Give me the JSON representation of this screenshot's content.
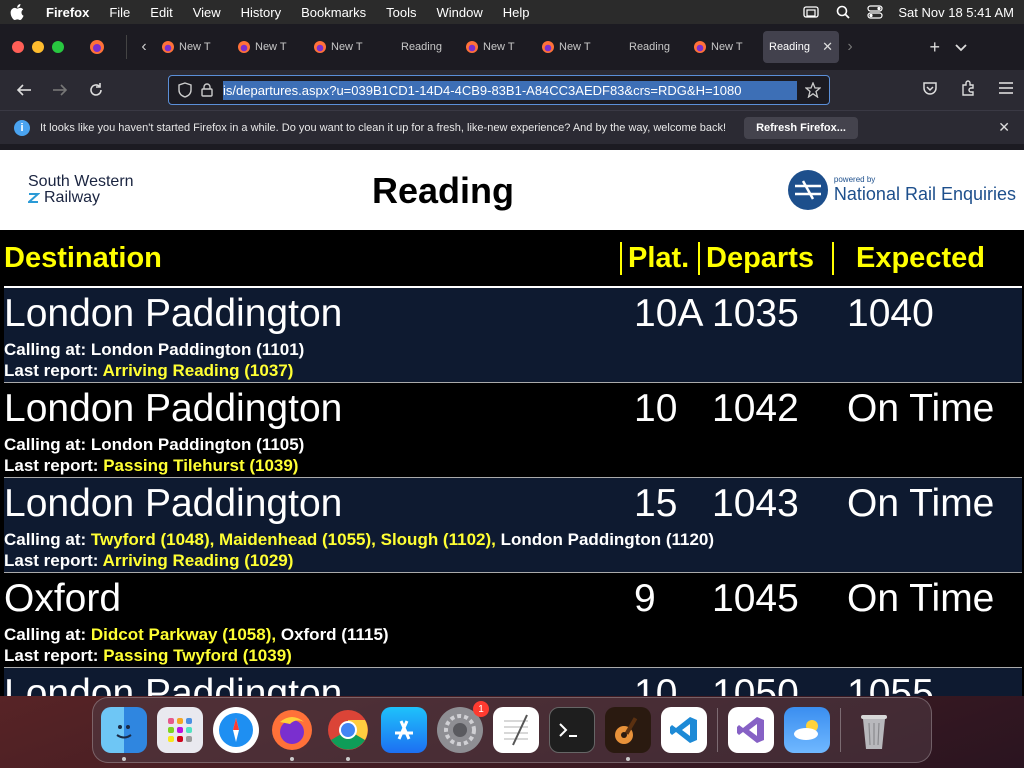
{
  "menubar": {
    "app_name": "Firefox",
    "items": [
      "File",
      "Edit",
      "View",
      "History",
      "Bookmarks",
      "Tools",
      "Window",
      "Help"
    ],
    "datetime": "Sat Nov 18  5:41 AM"
  },
  "browser": {
    "tabs": [
      {
        "label": "New T"
      },
      {
        "label": "New T"
      },
      {
        "label": "New T"
      },
      {
        "label": "Reading"
      },
      {
        "label": "New T"
      },
      {
        "label": "New T"
      },
      {
        "label": "Reading"
      },
      {
        "label": "New T"
      },
      {
        "label": "Reading",
        "active": true
      }
    ],
    "url": "is/departures.aspx?u=039B1CD1-14D4-4CB9-83B1-A84CC3AEDF83&crs=RDG&H=1080",
    "notification": {
      "text": "It looks like you haven't started Firefox in a while. Do you want to clean it up for a fresh, like-new experience? And by the way, welcome back!",
      "button": "Refresh Firefox..."
    }
  },
  "page": {
    "operator_logo_line1": "South Western",
    "operator_logo_line2": "Railway",
    "title": "Reading",
    "nre_small": "powered by",
    "nre_big": "National Rail Enquiries",
    "headers": {
      "destination": "Destination",
      "platform": "Plat.",
      "departs": "Departs",
      "expected": "Expected"
    },
    "calling_label": "Calling at:",
    "report_label": "Last report:",
    "rows": [
      {
        "destination": "London Paddington",
        "platform": "10A",
        "departs": "1035",
        "expected": "1040",
        "calling_yellow": "",
        "calling_white": "London Paddington (1101)",
        "report": "Arriving Reading (1037)"
      },
      {
        "destination": "London Paddington",
        "platform": "10",
        "departs": "1042",
        "expected": "On Time",
        "calling_yellow": "",
        "calling_white": "London Paddington (1105)",
        "report": "Passing Tilehurst (1039)"
      },
      {
        "destination": "London Paddington",
        "platform": "15",
        "departs": "1043",
        "expected": "On Time",
        "calling_yellow": "Twyford (1048), Maidenhead (1055), Slough (1102),",
        "calling_white": "London Paddington (1120)",
        "report": "Arriving Reading (1029)"
      },
      {
        "destination": "Oxford",
        "platform": "9",
        "departs": "1045",
        "expected": "On Time",
        "calling_yellow": "Didcot Parkway (1058),",
        "calling_white": "Oxford (1115)",
        "report": "Passing Twyford (1039)"
      },
      {
        "destination": "London Paddington",
        "platform": "10",
        "departs": "1050",
        "expected": "1055"
      }
    ]
  },
  "dock": {
    "apps": [
      "finder-icon",
      "launchpad-icon",
      "safari-icon",
      "firefox-icon",
      "chrome-icon",
      "app-store-icon",
      "system-settings-icon",
      "textedit-icon",
      "terminal-icon",
      "garageband-icon",
      "vscode-icon",
      "visual-studio-icon",
      "weather-icon",
      "trash-icon"
    ],
    "settings_badge": "1"
  }
}
